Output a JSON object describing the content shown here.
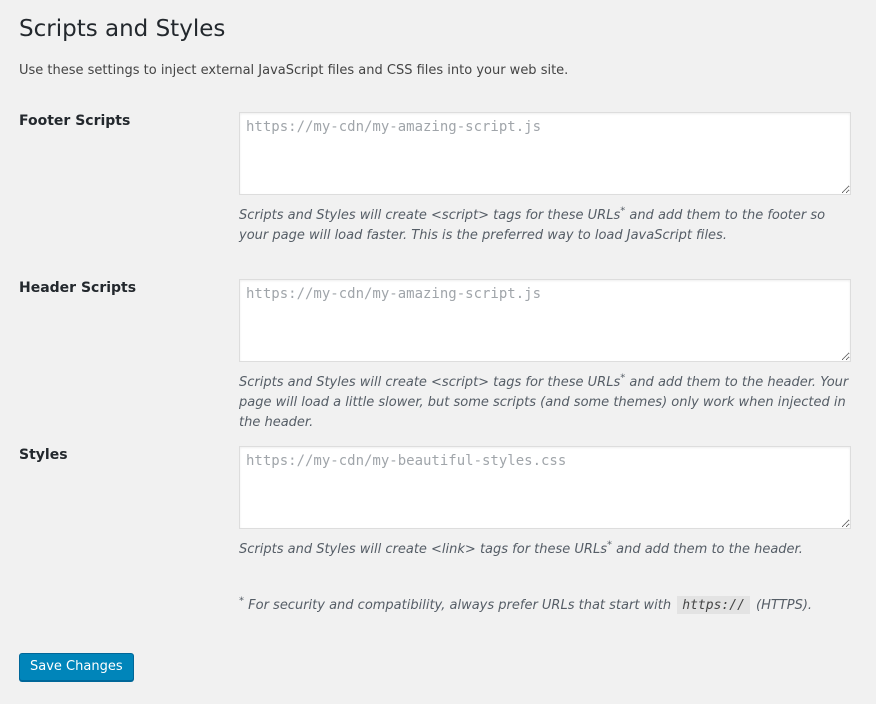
{
  "page": {
    "title": "Scripts and Styles",
    "intro": "Use these settings to inject external JavaScript files and CSS files into your web site."
  },
  "footer_scripts": {
    "label": "Footer Scripts",
    "placeholder": "https://my-cdn/my-amazing-script.js",
    "value": "",
    "desc_before": "Scripts and Styles will create <script> tags for these URLs",
    "desc_mark": "*",
    "desc_after": " and add them to the footer so your page will load faster. This is the preferred way to load JavaScript files."
  },
  "header_scripts": {
    "label": "Header Scripts",
    "placeholder": "https://my-cdn/my-amazing-script.js",
    "value": "",
    "desc_before": "Scripts and Styles will create <script> tags for these URLs",
    "desc_mark": "*",
    "desc_after": " and add them to the header. Your page will load a little slower, but some scripts (and some themes) only work when injected in the header."
  },
  "styles": {
    "label": "Styles",
    "placeholder": "https://my-cdn/my-beautiful-styles.css",
    "value": "",
    "desc_before": "Scripts and Styles will create <link> tags for these URLs",
    "desc_mark": "*",
    "desc_after": " and add them to the header."
  },
  "footnote": {
    "mark": "*",
    "before": " For security and compatibility, always prefer URLs that start with ",
    "code": "https://",
    "after": " (HTTPS)."
  },
  "actions": {
    "save_label": "Save Changes"
  },
  "colors": {
    "background": "#f1f1f1",
    "primary_button": "#0085ba",
    "description_text": "#555d66"
  }
}
